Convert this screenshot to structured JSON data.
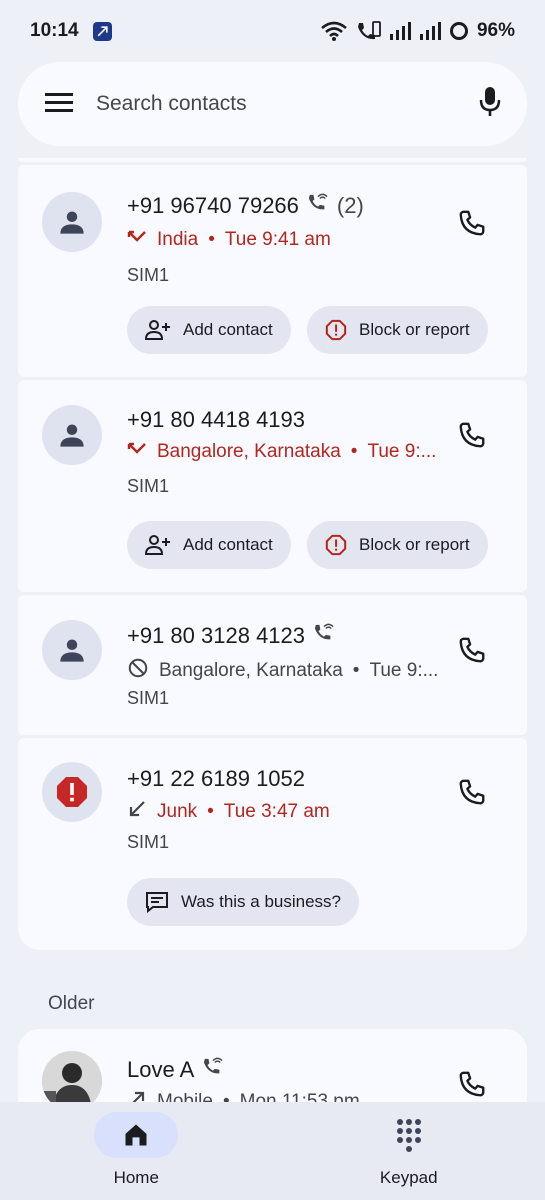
{
  "status": {
    "time": "10:14",
    "battery": "96%"
  },
  "search": {
    "placeholder": "Search contacts"
  },
  "calls": [
    {
      "number": "+91 96740 79266",
      "count": "(2)",
      "location": "India",
      "time": "Tue 9:41 am",
      "sim": "SIM1",
      "actions": [
        "Add contact",
        "Block or report"
      ]
    },
    {
      "number": "+91 80 4418 4193",
      "location": "Bangalore, Karnataka",
      "time": "Tue 9:...",
      "sim": "SIM1",
      "actions": [
        "Add contact",
        "Block or report"
      ]
    },
    {
      "number": "+91 80 3128 4123",
      "location": "Bangalore, Karnataka",
      "time": "Tue 9:...",
      "sim": "SIM1"
    },
    {
      "number": "+91 22 6189 1052",
      "location": "Junk",
      "time": "Tue 3:47 am",
      "sim": "SIM1",
      "actions": [
        "Was this a business?"
      ]
    }
  ],
  "older": {
    "label": "Older",
    "items": [
      {
        "name": "Love A",
        "type": "Mobile",
        "time": "Mon 11:53 pm"
      }
    ]
  },
  "separator": "•",
  "nav": {
    "home": "Home",
    "keypad": "Keypad"
  },
  "colors": {
    "missed": "#b3261e",
    "background": "#eef0f8",
    "card": "#f9faff",
    "chip": "#e3e6f1"
  }
}
